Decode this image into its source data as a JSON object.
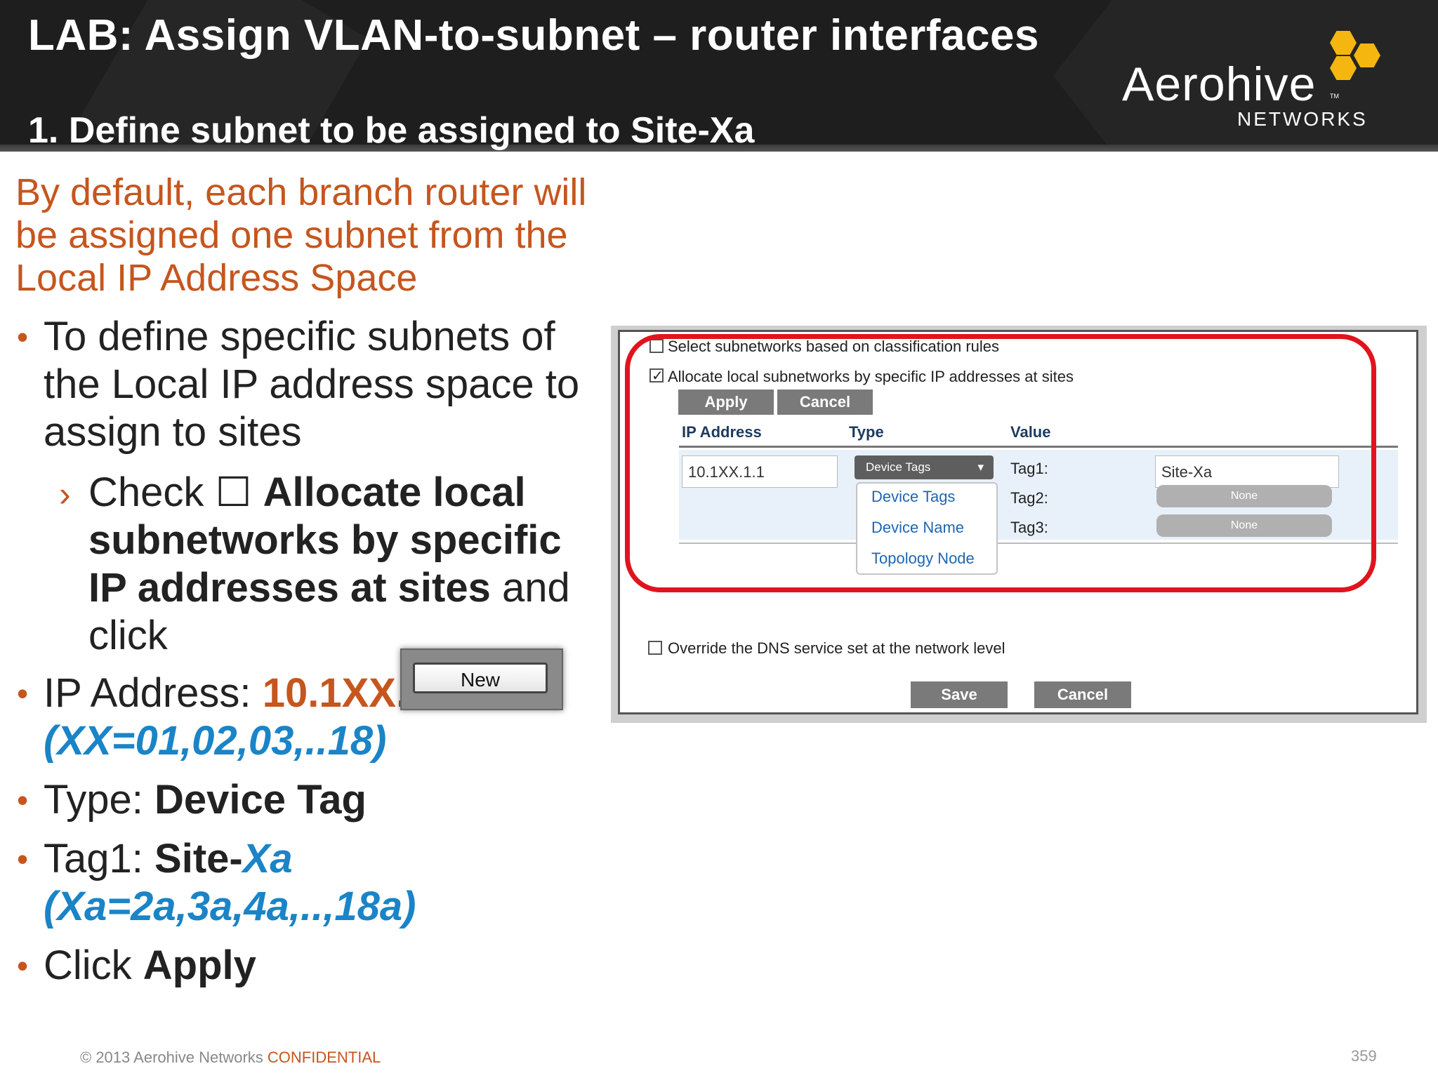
{
  "slide": {
    "title": "LAB: Assign VLAN-to-subnet – router interfaces",
    "subtitle": "1. Define subnet to be assigned to Site-Xa",
    "logo": {
      "word": "Aerohive",
      "tm": "TM",
      "sub": "NETWORKS"
    },
    "intro": "By default, each branch router will be assigned one subnet from the Local IP Address Space",
    "bullets": {
      "b1": "To define specific subnets of the Local IP address space  to assign to sites",
      "sub_check": "Check",
      "sub_box": "☐",
      "sub_bold": "Allocate local subnetworks by specific IP addresses at sites",
      "sub_tail": "and click",
      "ip_label": "IP Address:",
      "ip_value": "10.1XX.1.1",
      "ip_note": "(XX=01,02,03,..18)",
      "type_label": "Type:",
      "type_value": "Device Tag",
      "tag_label": "Tag1:",
      "tag_value_a": "Site-",
      "tag_value_b": "Xa",
      "tag_note": "(Xa=2a,3a,4a,..,18a)",
      "click_label": "Click",
      "click_value": "Apply"
    },
    "new_button": "New",
    "footer": {
      "copyright": "© 2013 Aerohive Networks",
      "confidential": "CONFIDENTIAL"
    },
    "page_number": "359"
  },
  "panel": {
    "opt1": "Select subnetworks based on classification rules",
    "opt2": "Allocate local subnetworks by specific IP addresses at sites",
    "apply": "Apply",
    "cancel": "Cancel",
    "col_ip": "IP Address",
    "col_type": "Type",
    "col_value": "Value",
    "ip_input": "10.1XX.1.1",
    "type_select": "Device Tags",
    "dropdown": [
      "Device Tags",
      "Device Name",
      "Topology Node"
    ],
    "tag1_label": "Tag1:",
    "tag2_label": "Tag2:",
    "tag3_label": "Tag3:",
    "tag1_value": "Site-Xa",
    "tag2_value": "None",
    "tag3_value": "None",
    "dns_override": "Override the DNS service set at the network level",
    "save": "Save",
    "cancel2": "Cancel"
  },
  "colors": {
    "accent_orange": "#c5561e",
    "accent_blue": "#1a84c7",
    "highlight_red": "#e0141e",
    "logo_yellow": "#f5b70f"
  }
}
